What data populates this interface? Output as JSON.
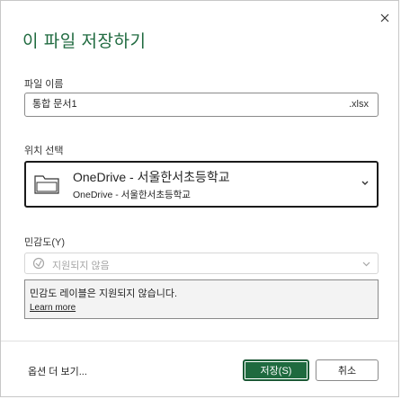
{
  "dialog": {
    "title": "이 파일 저장하기",
    "close_icon": "close-icon"
  },
  "filename": {
    "label": "파일 이름",
    "value": "통합 문서1",
    "extension": ".xlsx"
  },
  "location": {
    "label": "위치 선택",
    "icon": "folder-icon",
    "primary": "OneDrive - 서울한서초등학교",
    "secondary": "OneDrive - 서울한서초등학교"
  },
  "sensitivity": {
    "label": "민감도(Y)",
    "icon": "sensitivity-icon",
    "value": "지원되지 않음",
    "disabled": true,
    "message": "민감도 레이블은 지원되지 않습니다.",
    "learn_more": "Learn more"
  },
  "footer": {
    "more_options": "옵션 더 보기...",
    "save_label": "저장(S)",
    "cancel_label": "취소"
  },
  "colors": {
    "accent": "#1f6a3f",
    "border": "#8a8a8a",
    "disabled_text": "#a6a6a6"
  }
}
